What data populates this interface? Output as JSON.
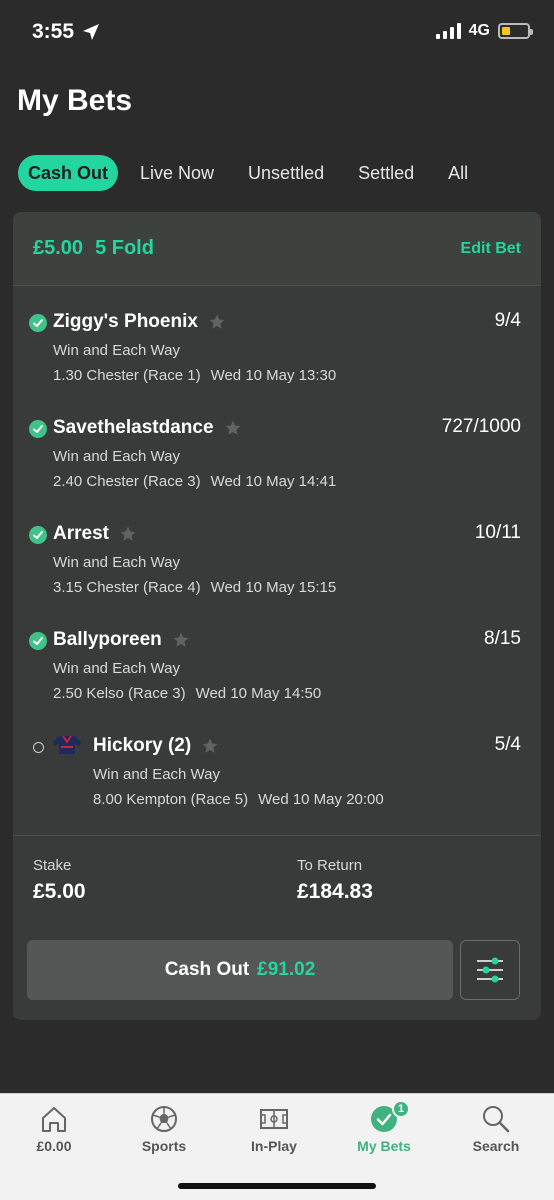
{
  "status_bar": {
    "time": "3:55",
    "network": "4G",
    "battery_level": 0.35
  },
  "page": {
    "title": "My Bets"
  },
  "tabs": [
    {
      "label": "Cash Out",
      "active": true
    },
    {
      "label": "Live Now",
      "active": false
    },
    {
      "label": "Unsettled",
      "active": false
    },
    {
      "label": "Settled",
      "active": false
    },
    {
      "label": "All",
      "active": false
    }
  ],
  "bet": {
    "stake_header": "£5.00",
    "bet_type": "5 Fold",
    "edit_label": "Edit Bet",
    "selections": [
      {
        "name": "Ziggy's Phoenix",
        "odds": "9/4",
        "market": "Win and Each Way",
        "race": "1.30 Chester (Race 1)",
        "time": "Wed 10 May 13:30",
        "status": "won"
      },
      {
        "name": "Savethelastdance",
        "odds": "727/1000",
        "market": "Win and Each Way",
        "race": "2.40 Chester (Race 3)",
        "time": "Wed 10 May 14:41",
        "status": "won"
      },
      {
        "name": "Arrest",
        "odds": "10/11",
        "market": "Win and Each Way",
        "race": "3.15 Chester (Race 4)",
        "time": "Wed 10 May 15:15",
        "status": "won"
      },
      {
        "name": "Ballyporeen",
        "odds": "8/15",
        "market": "Win and Each Way",
        "race": "2.50 Kelso (Race 3)",
        "time": "Wed 10 May 14:50",
        "status": "won"
      },
      {
        "name": "Hickory (2)",
        "odds": "5/4",
        "market": "Win and Each Way",
        "race": "8.00 Kempton (Race 5)",
        "time": "Wed 10 May 20:00",
        "status": "pending"
      }
    ],
    "stake_label": "Stake",
    "stake_value": "£5.00",
    "return_label": "To Return",
    "return_value": "£184.83",
    "cashout_label": "Cash Out",
    "cashout_value": "£91.02"
  },
  "nav": [
    {
      "label": "£0.00",
      "icon": "home-icon"
    },
    {
      "label": "Sports",
      "icon": "football-icon"
    },
    {
      "label": "In-Play",
      "icon": "pitch-icon"
    },
    {
      "label": "My Bets",
      "icon": "my-bets-icon",
      "active": true,
      "badge": "1"
    },
    {
      "label": "Search",
      "icon": "search-icon"
    }
  ],
  "colors": {
    "accent": "#23d6a0",
    "won": "#40c389",
    "background": "#2b2b2b",
    "card": "#383b39"
  }
}
